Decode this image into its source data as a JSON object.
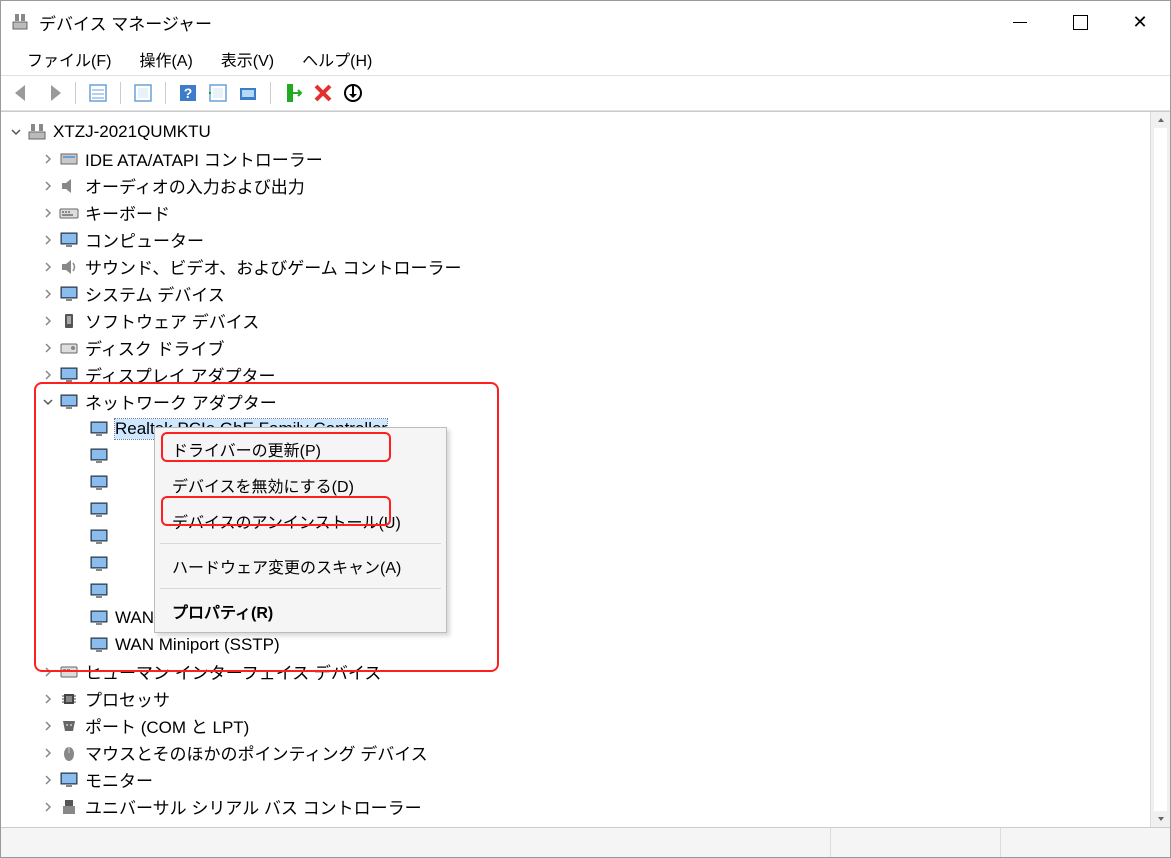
{
  "window": {
    "title": "デバイス マネージャー"
  },
  "menubar": {
    "file": "ファイル(F)",
    "action": "操作(A)",
    "view": "表示(V)",
    "help": "ヘルプ(H)"
  },
  "tree": {
    "root": "XTZJ-2021QUMKTU",
    "ide": "IDE ATA/ATAPI コントローラー",
    "audio": "オーディオの入力および出力",
    "keyboard": "キーボード",
    "computer": "コンピューター",
    "sound": "サウンド、ビデオ、およびゲーム コントローラー",
    "system": "システム デバイス",
    "software": "ソフトウェア デバイス",
    "disk": "ディスク ドライブ",
    "display": "ディスプレイ アダプター",
    "network": "ネットワーク アダプター",
    "net_selected": "Realtek PCIe GbE Family Controller",
    "net_hidden": "WAN Miniport (PPTP)",
    "net_sstp": "WAN Miniport (SSTP)",
    "hid": "ヒューマン インターフェイス デバイス",
    "processor": "プロセッサ",
    "ports": "ポート (COM と LPT)",
    "mouse": "マウスとそのほかのポインティング デバイス",
    "monitor": "モニター",
    "usb": "ユニバーサル シリアル バス コントローラー"
  },
  "context_menu": {
    "update": "ドライバーの更新(P)",
    "disable": "デバイスを無効にする(D)",
    "uninstall": "デバイスのアンインストール(U)",
    "scan": "ハードウェア変更のスキャン(A)",
    "properties": "プロパティ(R)"
  }
}
